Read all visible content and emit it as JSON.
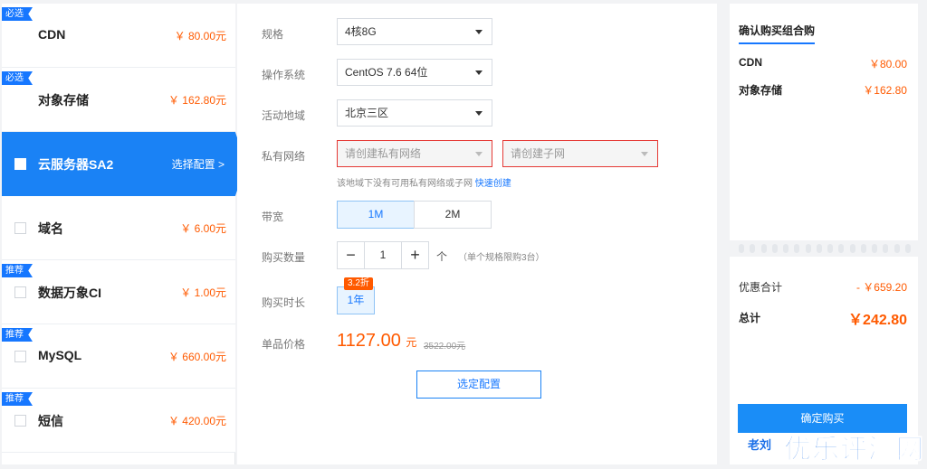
{
  "products": [
    {
      "name": "CDN",
      "price": "￥ 80.00元",
      "tag": "必选"
    },
    {
      "name": "对象存储",
      "price": "￥ 162.80元",
      "tag": "必选"
    },
    {
      "name": "云服务器SA2",
      "action": "选择配置 >"
    },
    {
      "name": "域名",
      "price": "￥ 6.00元"
    },
    {
      "name": "数据万象CI",
      "price": "￥ 1.00元",
      "tag": "推荐"
    },
    {
      "name": "MySQL",
      "price": "￥ 660.00元",
      "tag": "推荐"
    },
    {
      "name": "短信",
      "price": "￥ 420.00元",
      "tag": "推荐"
    }
  ],
  "form": {
    "spec_label": "规格",
    "spec_value": "4核8G",
    "os_label": "操作系统",
    "os_value": "CentOS 7.6 64位",
    "region_label": "活动地域",
    "region_value": "北京三区",
    "vpc_label": "私有网络",
    "vpc_placeholder": "请创建私有网络",
    "subnet_placeholder": "请创建子网",
    "hint_text": "该地域下没有可用私有网络或子网",
    "hint_link": "快速创建",
    "bandwidth_label": "带宽",
    "bandwidth_options": [
      "1M",
      "2M"
    ],
    "qty_label": "购买数量",
    "qty_minus": "−",
    "qty_value": "1",
    "qty_plus": "+",
    "qty_unit": "个",
    "qty_limit": "（单个规格限购3台）",
    "duration_label": "购买时长",
    "duration_value": "1年",
    "discount": "3.2折",
    "unit_price_label": "单品价格",
    "unit_price": "1127.00",
    "unit_price_unit": "元",
    "original_price": "3522.00元",
    "select_button": "选定配置"
  },
  "summary": {
    "title": "确认购买组合购",
    "lines": [
      {
        "name": "CDN",
        "price": "￥80.00"
      },
      {
        "name": "对象存储",
        "price": "￥162.80"
      }
    ],
    "discount_label": "优惠合计",
    "discount_value": "- ￥659.20",
    "total_label": "总计",
    "total_value": "￥242.80",
    "buy_button": "确定购买"
  },
  "watermark": {
    "main": "优乐评测网",
    "sub": "老刘"
  },
  "colors": {
    "accent": "#1677ff",
    "price": "#ff5a00",
    "error": "#e53935"
  }
}
